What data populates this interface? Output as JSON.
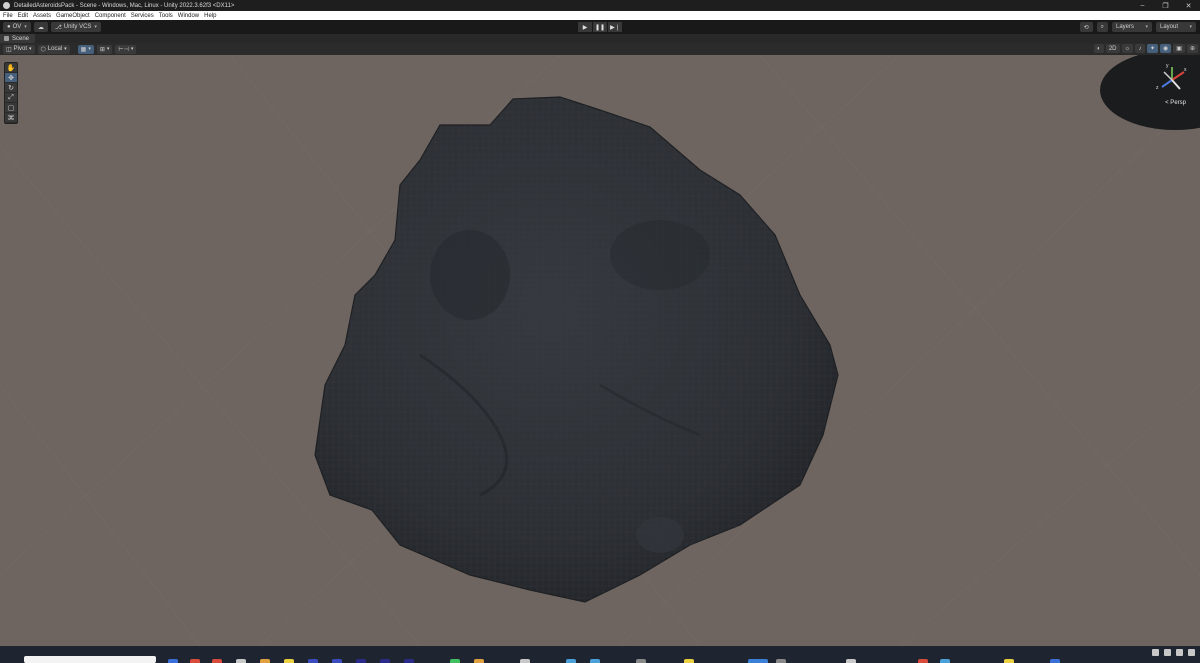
{
  "window": {
    "title": "DetailedAsteroidsPack - Scene - Windows, Mac, Linux - Unity 2022.3.62f3 <DX11>",
    "controls": [
      "–",
      "❐",
      "✕"
    ]
  },
  "menu": [
    "File",
    "Edit",
    "Assets",
    "GameObject",
    "Component",
    "Services",
    "Tools",
    "Window",
    "Help"
  ],
  "toolbar": {
    "account_label": "OV",
    "vcs_label": "Unity VCS",
    "play_icons": [
      "▶",
      "❚❚",
      "▶❘"
    ],
    "layers_label": "Layers",
    "layout_label": "Layout"
  },
  "scene_tab": {
    "label": "Scene"
  },
  "scene_toolbar": {
    "pivot_label": "Pivot",
    "local_label": "Local",
    "mode_2d_label": "2D"
  },
  "gizmo": {
    "projection_label": "< Persp",
    "axis_labels": {
      "x": "x",
      "y": "y",
      "z": "z"
    }
  },
  "tools": [
    "hand-tool",
    "move-tool",
    "rotate-tool",
    "scale-tool",
    "rect-tool",
    "transform-tool"
  ],
  "colors": {
    "viewport_background": "#6f6560",
    "asteroid": "#2e3136",
    "accent_active": "#46607c",
    "gizmo_x": "#d8443a",
    "gizmo_z": "#4a78d8"
  }
}
